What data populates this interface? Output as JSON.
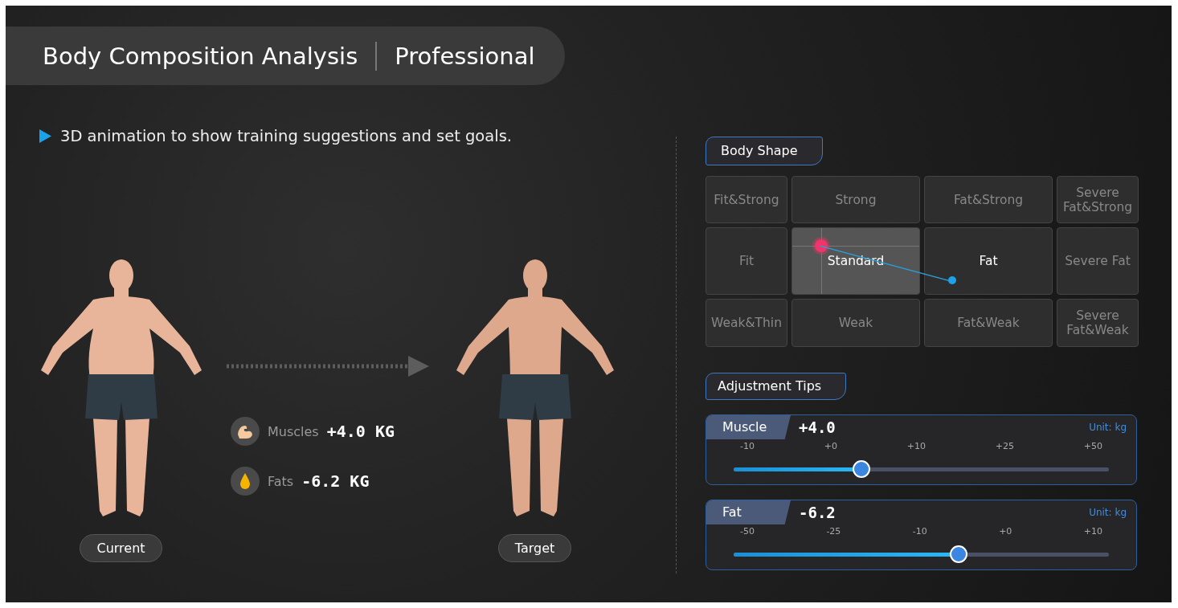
{
  "header": {
    "title": "Body Composition Analysis",
    "edition": "Professional"
  },
  "intro": "3D animation to show training suggestions and set goals.",
  "figures": [
    {
      "label": "Current",
      "kind": "current"
    },
    {
      "label": "Target",
      "kind": "target"
    }
  ],
  "changes": [
    {
      "kind": "muscle",
      "label": "Muscles",
      "value": "+4.0 KG"
    },
    {
      "kind": "fat",
      "label": "Fats",
      "value": "-6.2 KG"
    }
  ],
  "body_shape": {
    "title": "Body Shape",
    "cells": [
      {
        "label": "Fit&Strong",
        "current": false,
        "target": false
      },
      {
        "label": "Strong",
        "current": false,
        "target": false
      },
      {
        "label": "Fat&Strong",
        "current": false,
        "target": false
      },
      {
        "label": "Severe Fat&Strong",
        "current": false,
        "target": false
      },
      {
        "label": "Fit",
        "current": false,
        "target": false
      },
      {
        "label": "Standard",
        "current": true,
        "target": false
      },
      {
        "label": "Fat",
        "current": false,
        "target": true
      },
      {
        "label": "Severe Fat",
        "current": false,
        "target": false
      },
      {
        "label": "Weak&Thin",
        "current": false,
        "target": false
      },
      {
        "label": "Weak",
        "current": false,
        "target": false
      },
      {
        "label": "Fat&Weak",
        "current": false,
        "target": false
      },
      {
        "label": "Severe Fat&Weak",
        "current": false,
        "target": false
      }
    ]
  },
  "adjustment_tips": {
    "title": "Adjustment Tips",
    "sliders": [
      {
        "name": "Muscle",
        "value": "+4.0",
        "unit": "Unit: kg",
        "ticks": [
          "-10",
          "+0",
          "+10",
          "+25",
          "+50"
        ],
        "level": 0.34
      },
      {
        "name": "Fat",
        "value": "-6.2",
        "unit": "Unit: kg",
        "ticks": [
          "-50",
          "-25",
          "-10",
          "+0",
          "+10"
        ],
        "level": 0.6
      }
    ]
  }
}
